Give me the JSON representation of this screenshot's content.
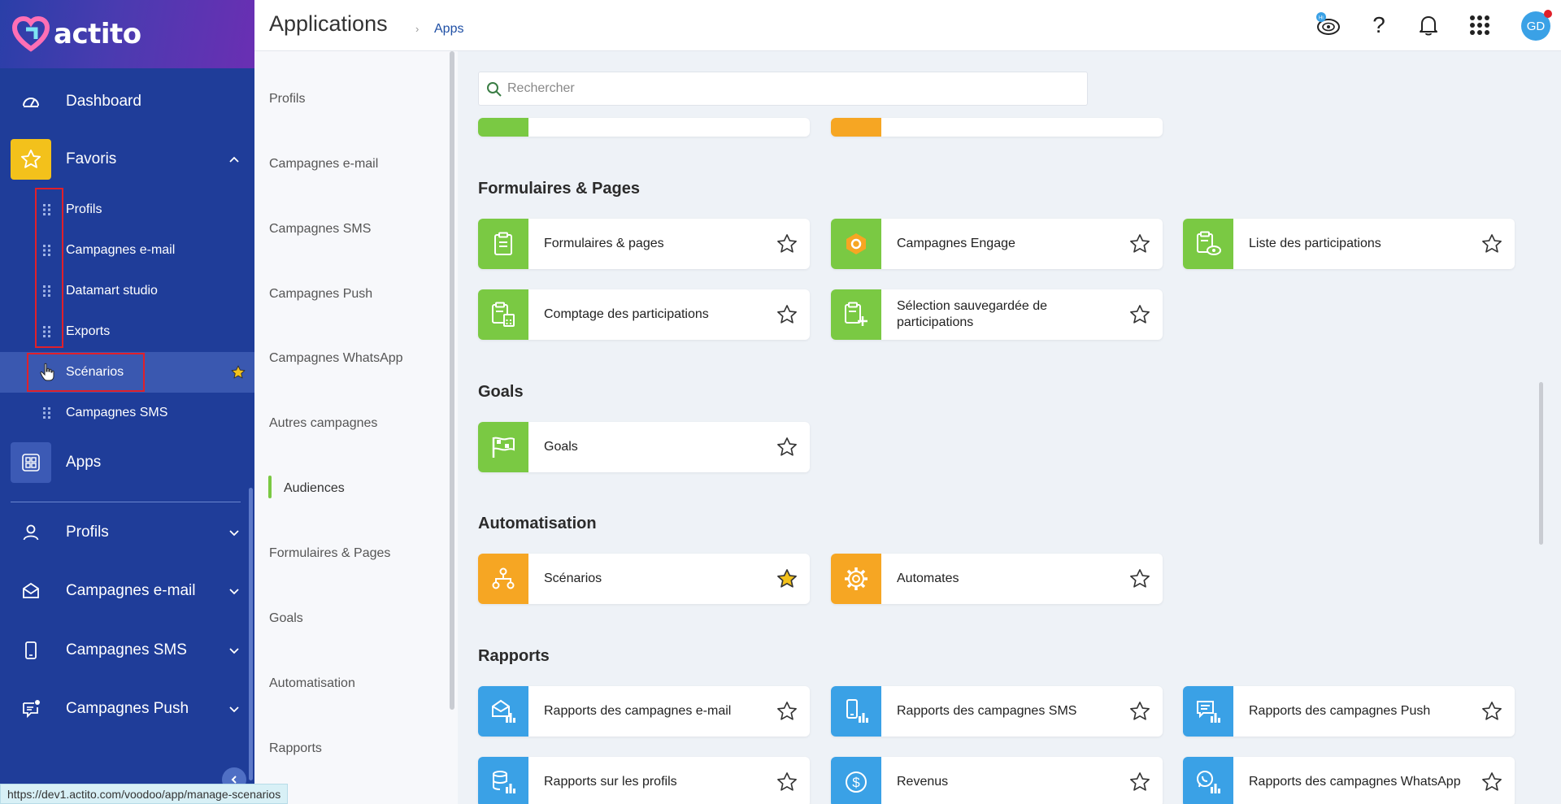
{
  "app": {
    "logo_text": "actito",
    "page_title": "Applications",
    "breadcrumb": "Apps",
    "status_url": "https://dev1.actito.com/voodoo/app/manage-scenarios",
    "help_label": "?",
    "avatar_initials": "GD",
    "accent": "#1f3d99"
  },
  "sidebar": {
    "dashboard": "Dashboard",
    "favoris": "Favoris",
    "favorites": [
      "Profils",
      "Campagnes e-mail",
      "Datamart studio",
      "Exports",
      "Scénarios",
      "Campagnes SMS"
    ],
    "apps": "Apps",
    "sections": [
      "Profils",
      "Campagnes e-mail",
      "Campagnes SMS",
      "Campagnes Push"
    ]
  },
  "categories": [
    "Profils",
    "Campagnes e-mail",
    "Campagnes SMS",
    "Campagnes Push",
    "Campagnes WhatsApp",
    "Autres campagnes",
    "Audiences",
    "Formulaires & Pages",
    "Goals",
    "Automatisation",
    "Rapports"
  ],
  "search": {
    "placeholder": "Rechercher"
  },
  "sections": {
    "formulaires": {
      "title": "Formulaires & Pages",
      "cards": [
        "Formulaires & pages",
        "Campagnes Engage",
        "Liste des participations",
        "Comptage des participations",
        "Sélection sauvegardée de participations"
      ]
    },
    "goals": {
      "title": "Goals",
      "cards": [
        "Goals"
      ]
    },
    "automatisation": {
      "title": "Automatisation",
      "cards": [
        "Scénarios",
        "Automates"
      ]
    },
    "rapports": {
      "title": "Rapports",
      "cards": [
        "Rapports des campagnes e-mail",
        "Rapports des campagnes SMS",
        "Rapports des campagnes Push",
        "Rapports sur les profils",
        "Revenus",
        "Rapports des campagnes WhatsApp"
      ]
    }
  },
  "colors": {
    "green": "#7ac943",
    "orange": "#f6a623",
    "blue": "#3aa1e6",
    "favorite_star": "#f3c11b"
  }
}
